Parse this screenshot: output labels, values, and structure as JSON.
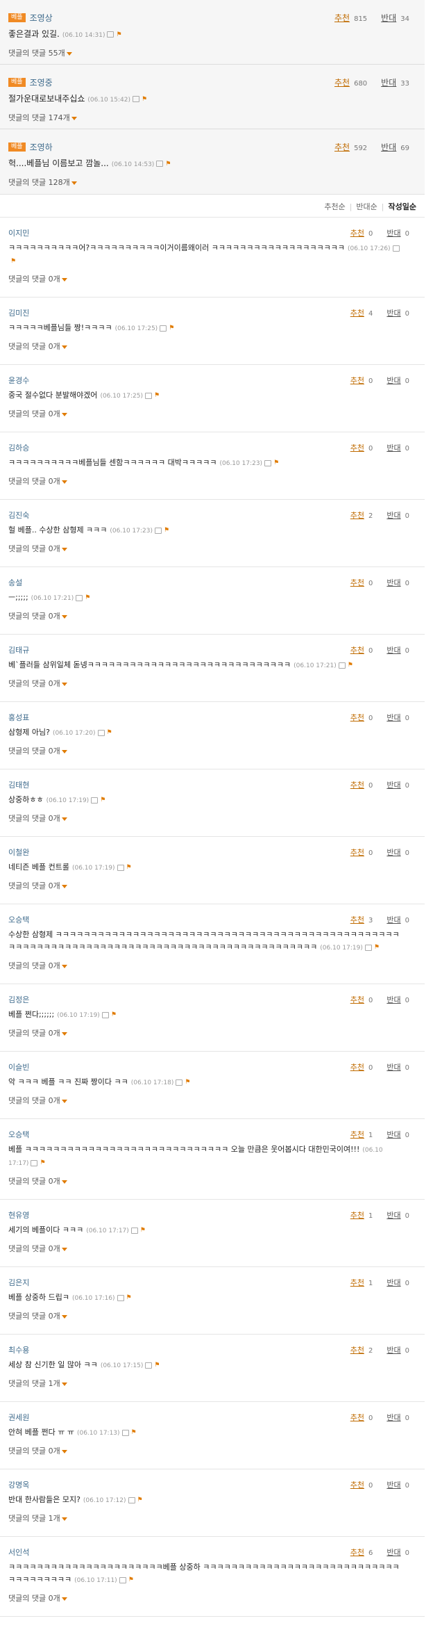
{
  "best_label": "베플",
  "reply_link_prefix": "댓글의 댓글",
  "best": [
    {
      "author": "조영상",
      "text": "좋은결과 있길.",
      "date": "(06.10 14:31)",
      "rec_label": "추천",
      "rec": "815",
      "opp_label": "반대",
      "opp": "34",
      "replies": "55개"
    },
    {
      "author": "조영중",
      "text": "절가운대로보내주십쇼",
      "date": "(06.10 15:42)",
      "rec_label": "추천",
      "rec": "680",
      "opp_label": "반대",
      "opp": "33",
      "replies": "174개"
    },
    {
      "author": "조영하",
      "text": "헉....베플님 이름보고 깜놀...",
      "date": "(06.10 14:53)",
      "rec_label": "추천",
      "rec": "592",
      "opp_label": "반대",
      "opp": "69",
      "replies": "128개"
    }
  ],
  "sort": {
    "recommend": "추천순",
    "oppose": "반대순",
    "latest": "작성일순"
  },
  "comments": [
    {
      "author": "이지민",
      "text": "ㅋㅋㅋㅋㅋㅋㅋㅋㅋㅋ어?ㅋㅋㅋㅋㅋㅋㅋㅋㅋㅋ이거이름왜이러 ㅋㅋㅋㅋㅋㅋㅋㅋㅋㅋㅋㅋㅋㅋㅋㅋㅋㅋㅋ",
      "date": "(06.10 17:26)",
      "rec": "0",
      "opp": "0",
      "replies": "0개"
    },
    {
      "author": "김미진",
      "text": "ㅋㅋㅋㅋㅋ베플님들 짱!ㅋㅋㅋㅋ",
      "date": "(06.10 17:25)",
      "rec": "4",
      "opp": "0",
      "replies": "0개"
    },
    {
      "author": "윤경수",
      "text": "중국 절수없다 분발해야겠어",
      "date": "(06.10 17:25)",
      "rec": "0",
      "opp": "0",
      "replies": "0개"
    },
    {
      "author": "김하승",
      "text": "ㅋㅋㅋㅋㅋㅋㅋㅋㅋㅋ베플님들 센함ㅋㅋㅋㅋㅋㅋ 대박ㅋㅋㅋㅋㅋ",
      "date": "(06.10 17:23)",
      "rec": "0",
      "opp": "0",
      "replies": "0개"
    },
    {
      "author": "김진숙",
      "text": "헐 베플.. 수상한 삼형제 ㅋㅋㅋ",
      "date": "(06.10 17:23)",
      "rec": "2",
      "opp": "0",
      "replies": "0개"
    },
    {
      "author": "송설",
      "text": "ㅡ;;;;;",
      "date": "(06.10 17:21)",
      "rec": "0",
      "opp": "0",
      "replies": "0개"
    },
    {
      "author": "김태규",
      "text": "베`플러들 삼위일체 돋넹ㅋㅋㅋㅋㅋㅋㅋㅋㅋㅋㅋㅋㅋㅋㅋㅋㅋㅋㅋㅋㅋㅋㅋㅋㅋㅋㅋㅋㅋ",
      "date": "(06.10 17:21)",
      "rec": "0",
      "opp": "0",
      "replies": "0개"
    },
    {
      "author": "홍성표",
      "text": "삼형제 아님?",
      "date": "(06.10 17:20)",
      "rec": "0",
      "opp": "0",
      "replies": "0개"
    },
    {
      "author": "김태현",
      "text": "상중하ㅎㅎ",
      "date": "(06.10 17:19)",
      "rec": "0",
      "opp": "0",
      "replies": "0개"
    },
    {
      "author": "이철완",
      "text": "네티즌 베플 컨트롤",
      "date": "(06.10 17:19)",
      "rec": "0",
      "opp": "0",
      "replies": "0개"
    },
    {
      "author": "오승택",
      "text": "수상한 삼형제 ㅋㅋㅋㅋㅋㅋㅋㅋㅋㅋㅋㅋㅋㅋㅋㅋㅋㅋㅋㅋㅋㅋㅋㅋㅋㅋㅋㅋㅋㅋㅋㅋㅋㅋㅋㅋㅋㅋㅋㅋㅋㅋㅋㅋㅋㅋㅋㅋㅋㅋㅋㅋㅋㅋㅋㅋㅋㅋㅋㅋㅋㅋㅋㅋㅋㅋㅋㅋㅋㅋㅋㅋㅋㅋㅋㅋㅋㅋㅋㅋㅋㅋㅋㅋㅋㅋㅋㅋㅋㅋㅋㅋㅋ",
      "date": "(06.10 17:19)",
      "rec": "3",
      "opp": "0",
      "replies": "0개"
    },
    {
      "author": "김정은",
      "text": "베플 쩐다;;;;;;",
      "date": "(06.10 17:19)",
      "rec": "0",
      "opp": "0",
      "replies": "0개"
    },
    {
      "author": "이슬빈",
      "text": "악 ㅋㅋㅋ 베플 ㅋㅋ 진짜 짱이다 ㅋㅋ",
      "date": "(06.10 17:18)",
      "rec": "0",
      "opp": "0",
      "replies": "0개"
    },
    {
      "author": "오승택",
      "text": "베플 ㅋㅋㅋㅋㅋㅋㅋㅋㅋㅋㅋㅋㅋㅋㅋㅋㅋㅋㅋㅋㅋㅋㅋㅋㅋㅋㅋㅋㅋ 오늘 만큼은 웃어봅시다 대한민국이여!!!",
      "date": "(06.10 17:17)",
      "rec": "1",
      "opp": "0",
      "replies": "0개"
    },
    {
      "author": "현유영",
      "text": "세기의 베플이다 ㅋㅋㅋ",
      "date": "(06.10 17:17)",
      "rec": "1",
      "opp": "0",
      "replies": "0개"
    },
    {
      "author": "김은지",
      "text": "베플 상중하 드립ㅋ",
      "date": "(06.10 17:16)",
      "rec": "1",
      "opp": "0",
      "replies": "0개"
    },
    {
      "author": "최수용",
      "text": "세상 참 신기한 일 많아 ㅋㅋ",
      "date": "(06.10 17:15)",
      "rec": "2",
      "opp": "0",
      "replies": "1개"
    },
    {
      "author": "권세원",
      "text": "안혀 베플 쩐다 ㅠ ㅠ",
      "date": "(06.10 17:13)",
      "rec": "0",
      "opp": "0",
      "replies": "0개"
    },
    {
      "author": "강명옥",
      "text": "반대 한사람들은 모지?",
      "date": "(06.10 17:12)",
      "rec": "0",
      "opp": "0",
      "replies": "1개"
    },
    {
      "author": "서인석",
      "text": "ㅋㅋㅋㅋㅋㅋㅋㅋㅋㅋㅋㅋㅋㅋㅋㅋㅋㅋㅋㅋㅋㅋ베플 상중하 ㅋㅋㅋㅋㅋㅋㅋㅋㅋㅋㅋㅋㅋㅋㅋㅋㅋㅋㅋㅋㅋㅋㅋㅋㅋㅋㅋㅋㅋㅋㅋㅋㅋㅋㅋㅋㅋ",
      "date": "(06.10 17:11)",
      "rec": "6",
      "opp": "0",
      "replies": "0개"
    }
  ],
  "rec_label": "추천",
  "opp_label": "반대"
}
